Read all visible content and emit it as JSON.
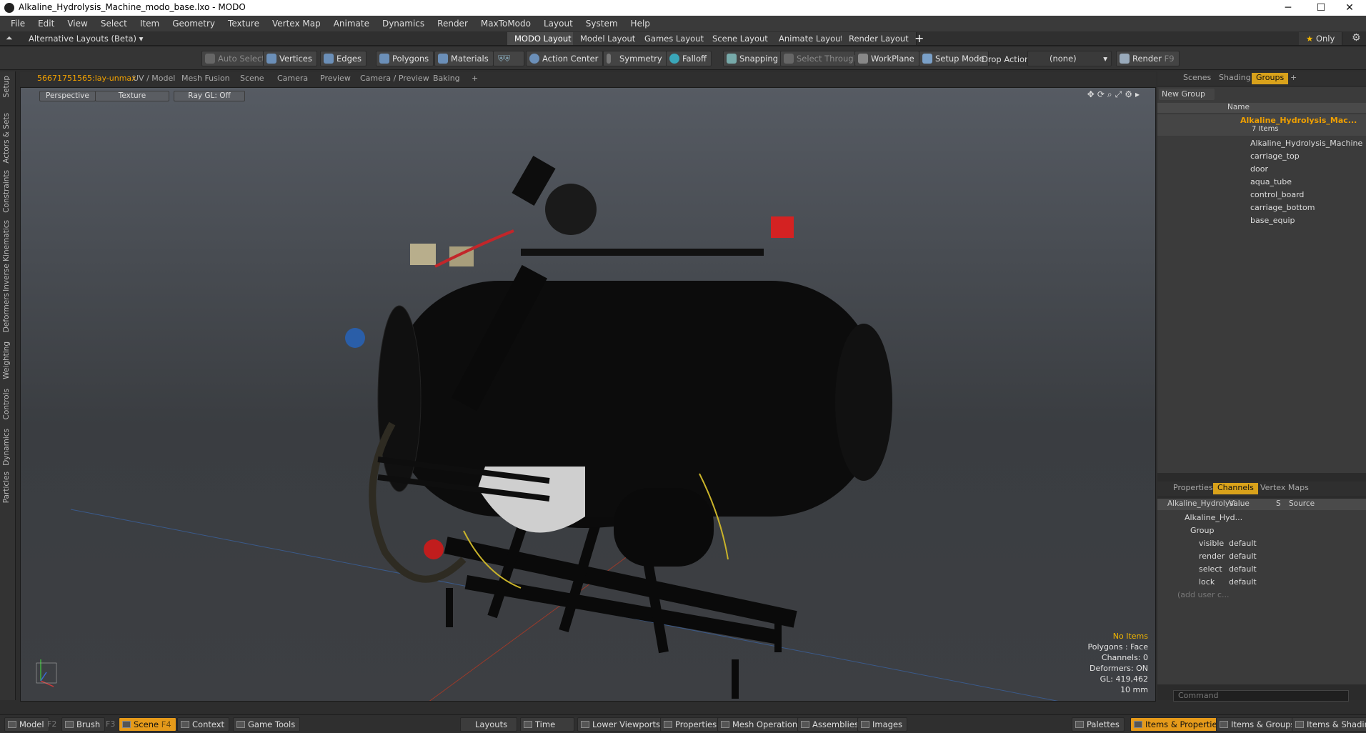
{
  "window": {
    "title": "Alkaline_Hydrolysis_Machine_modo_base.lxo - MODO"
  },
  "menu": [
    "File",
    "Edit",
    "View",
    "Select",
    "Item",
    "Geometry",
    "Texture",
    "Vertex Map",
    "Animate",
    "Dynamics",
    "Render",
    "MaxToModo",
    "Layout",
    "System",
    "Help"
  ],
  "layouts": {
    "alt": "Alternative Layouts (Beta) ▾",
    "tabs": [
      "MODO Layout",
      "Model Layout",
      "Games Layout",
      "Scene Layout",
      "Animate Layout",
      "Render Layout"
    ],
    "only": "Only"
  },
  "toolbar": {
    "auto_select": "Auto Select",
    "vertices": "Vertices",
    "edges": "Edges",
    "polygons": "Polygons",
    "materials": "Materials",
    "action_center": "Action Center",
    "symmetry": "Symmetry",
    "falloff": "Falloff",
    "snapping": "Snapping",
    "select_through": "Select Through",
    "workplane": "WorkPlane",
    "setup_mode": "Setup Mode",
    "drop_action": "Drop Action",
    "drop_value": "(none)",
    "render": "Render",
    "render_key": "F9"
  },
  "vp_tabs": [
    "56671751565:lay-unmax",
    "UV / Model",
    "Mesh Fusion",
    "Scene",
    "Camera",
    "Preview",
    "Camera / Preview",
    "Baking"
  ],
  "viewport": {
    "view": "Perspective",
    "shading": "Texture",
    "raygl": "Ray GL: Off",
    "info": [
      "No Items",
      "Polygons : Face",
      "Channels: 0",
      "Deformers: ON",
      "GL: 419,462",
      "10 mm"
    ]
  },
  "left_tabs": [
    "Setup",
    "Actors & Sets",
    "Constraints",
    "Inverse Kinematics",
    "Deformers",
    "Weighting",
    "Controls",
    "Dynamics",
    "Particles"
  ],
  "right": {
    "tabs": [
      "Scenes",
      "Shading",
      "Groups"
    ],
    "new_group": "New Group",
    "col_name": "Name",
    "group_name": "Alkaline_Hydrolysis_Mac...",
    "items_count": "7 Items",
    "items": [
      "Alkaline_Hydrolysis_Machine",
      "carriage_top",
      "door",
      "aqua_tube",
      "control_board",
      "carriage_bottom",
      "base_equip"
    ],
    "ptabs": [
      "Properties",
      "Channels",
      "Vertex Maps"
    ],
    "chan_head": [
      "Alkaline_Hydrolysi...",
      "Value",
      "S",
      "Source"
    ],
    "chan_root": "Alkaline_Hyd...",
    "chan_group": "Group",
    "channels": [
      {
        "n": "visible",
        "v": "default"
      },
      {
        "n": "render",
        "v": "default"
      },
      {
        "n": "select",
        "v": "default"
      },
      {
        "n": "lock",
        "v": "default"
      }
    ],
    "add_user": "(add user c...",
    "command": "Command"
  },
  "bottom": {
    "left": [
      {
        "l": "Model",
        "k": "F2"
      },
      {
        "l": "Brush",
        "k": "F3"
      },
      {
        "l": "Scene",
        "k": "F4"
      },
      {
        "l": "Context"
      },
      {
        "l": "Game Tools"
      }
    ],
    "mid": [
      "Layouts",
      "Time",
      "Lower Viewports",
      "Properties",
      "Mesh Operations",
      "Assemblies",
      "Images"
    ],
    "right": [
      "Palettes",
      "Items & Properties",
      "Items & Groups",
      "Items & Shading"
    ]
  }
}
